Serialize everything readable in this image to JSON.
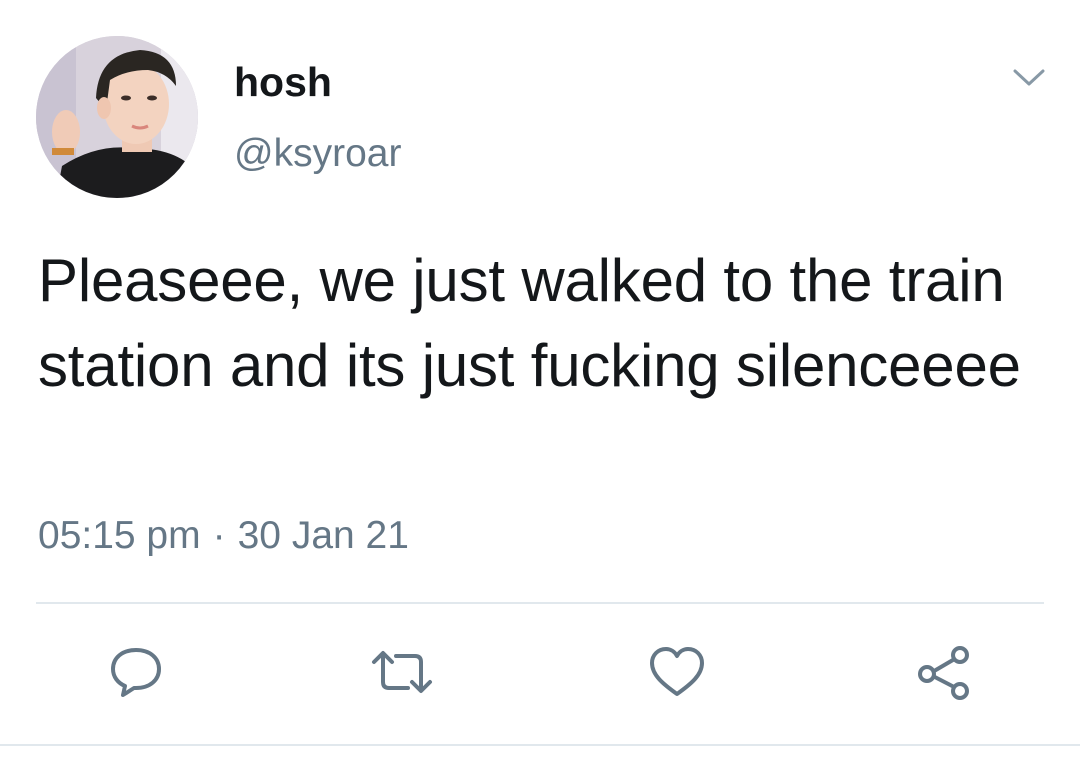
{
  "tweet": {
    "author": {
      "display_name": "hosh",
      "handle": "@ksyroar"
    },
    "text": "Pleaseee, we just walked to the train station and its just fucking silenceeee",
    "time": "05:15 pm",
    "separator": "·",
    "date": "30 Jan 21"
  },
  "icons": {
    "more": "chevron-down-icon",
    "reply": "reply-icon",
    "retweet": "retweet-icon",
    "like": "heart-icon",
    "share": "share-icon"
  },
  "colors": {
    "text": "#14171a",
    "secondary": "#657786",
    "icon": "#657786",
    "divider": "#e1e8ed"
  }
}
